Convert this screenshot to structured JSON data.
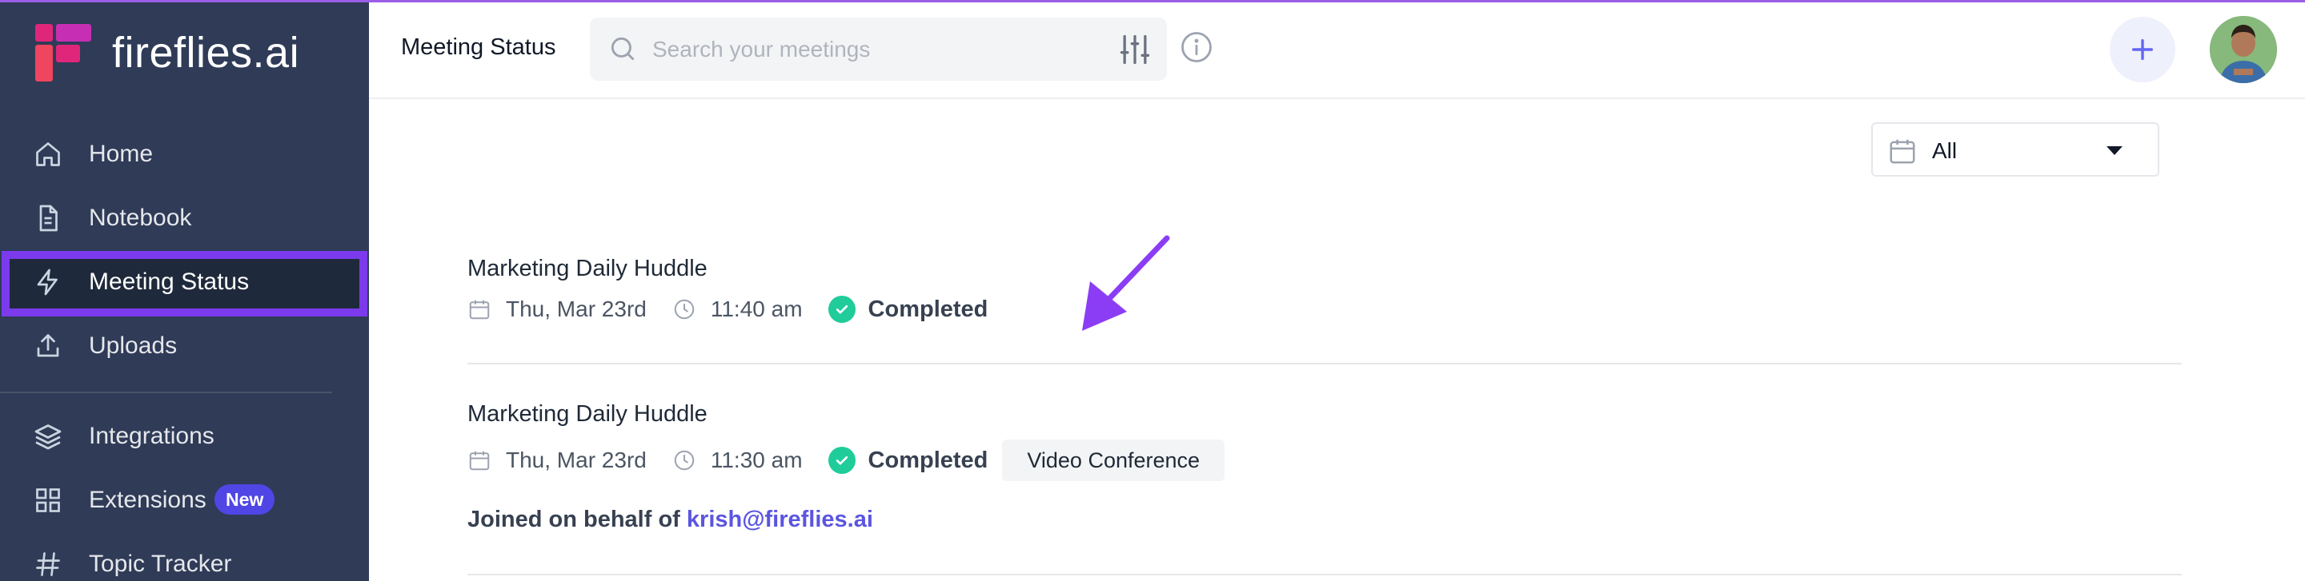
{
  "app": {
    "brand": "fireflies.ai"
  },
  "sidebar": {
    "items": [
      {
        "label": "Home",
        "icon": "home-icon"
      },
      {
        "label": "Notebook",
        "icon": "document-icon"
      },
      {
        "label": "Meeting Status",
        "icon": "lightning-icon",
        "active": true
      },
      {
        "label": "Uploads",
        "icon": "upload-icon"
      },
      {
        "label": "Integrations",
        "icon": "layers-icon"
      },
      {
        "label": "Extensions",
        "icon": "grid-icon",
        "badge": "New"
      },
      {
        "label": "Topic Tracker",
        "icon": "hashtag-icon"
      }
    ]
  },
  "header": {
    "title": "Meeting Status",
    "search_placeholder": "Search your meetings"
  },
  "filter": {
    "value": "All"
  },
  "meetings": [
    {
      "title": "Marketing Daily Huddle",
      "date": "Thu, Mar 23rd",
      "time": "11:40 am",
      "status": "Completed"
    },
    {
      "title": "Marketing Daily Huddle",
      "date": "Thu, Mar 23rd",
      "time": "11:30 am",
      "status": "Completed",
      "tag": "Video Conference",
      "joined_prefix": "Joined on behalf of",
      "joined_email": "krish@fireflies.ai"
    }
  ],
  "colors": {
    "sidebar_bg": "#2f3b57",
    "highlight": "#7c3aed",
    "completed": "#1fcc9a",
    "link": "#5b55e0",
    "badge": "#4f46e5"
  }
}
